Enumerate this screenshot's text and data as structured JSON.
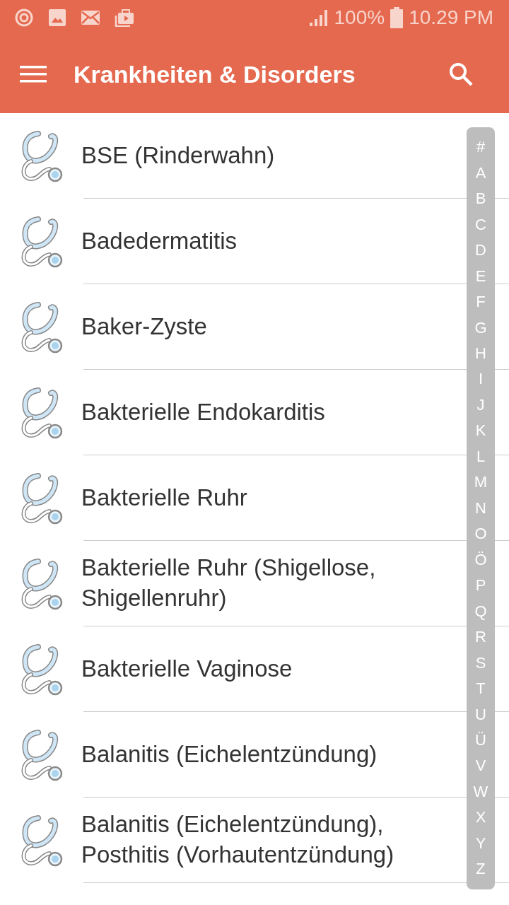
{
  "status_bar": {
    "battery": "100%",
    "time": "10.29 PM"
  },
  "app_bar": {
    "title": "Krankheiten & Disorders"
  },
  "items": [
    {
      "label": "BSE (Rinderwahn)"
    },
    {
      "label": "Badedermatitis"
    },
    {
      "label": "Baker-Zyste"
    },
    {
      "label": "Bakterielle Endokarditis"
    },
    {
      "label": "Bakterielle Ruhr"
    },
    {
      "label": "Bakterielle Ruhr (Shigellose, Shigellenruhr)"
    },
    {
      "label": "Bakterielle Vaginose"
    },
    {
      "label": "Balanitis (Eichelentzündung)"
    },
    {
      "label": "Balanitis (Eichelentzündung), Posthitis (Vorhautentzündung)"
    }
  ],
  "index_bar": [
    "#",
    "A",
    "B",
    "C",
    "D",
    "E",
    "F",
    "G",
    "H",
    "I",
    "J",
    "K",
    "L",
    "M",
    "N",
    "O",
    "Ö",
    "P",
    "Q",
    "R",
    "S",
    "T",
    "U",
    "Ü",
    "V",
    "W",
    "X",
    "Y",
    "Z"
  ]
}
